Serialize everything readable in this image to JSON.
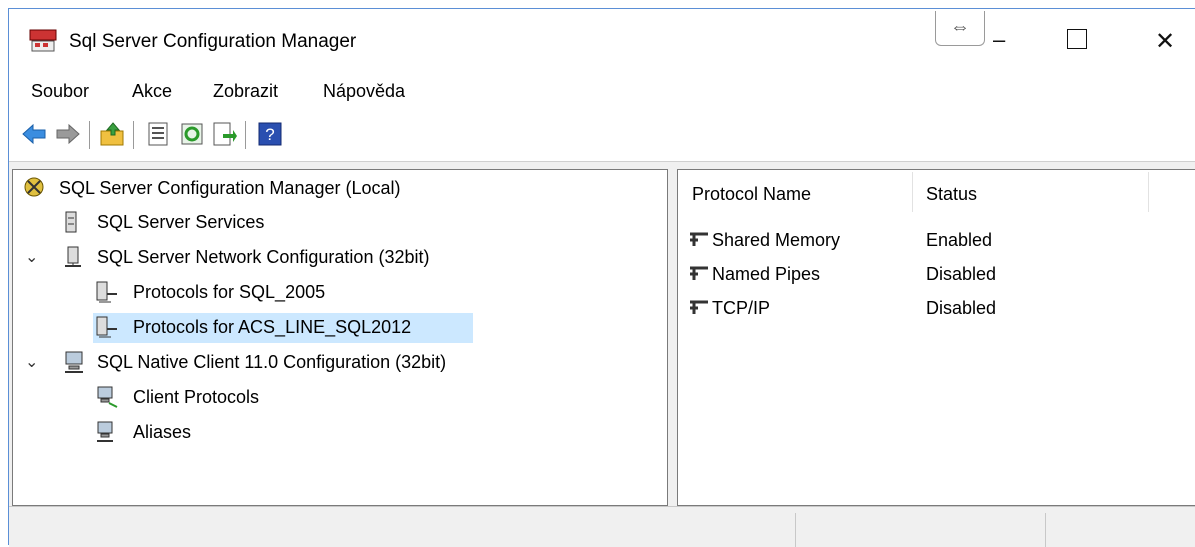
{
  "window": {
    "title": "Sql Server Configuration Manager",
    "controls": {
      "resize_hint": "⇔",
      "minimize": "–",
      "close": "✕"
    }
  },
  "menu": [
    "Soubor",
    "Akce",
    "Zobrazit",
    "Nápověda"
  ],
  "toolbar": {
    "icons": [
      "back-arrow-icon",
      "forward-arrow-icon",
      "up-folder-icon",
      "properties-icon",
      "refresh-icon",
      "export-list-icon",
      "help-icon"
    ]
  },
  "tree": {
    "root": "SQL Server Configuration Manager (Local)",
    "items": [
      {
        "label": "SQL Server Services",
        "level": 1
      },
      {
        "label": "SQL Server Network Configuration (32bit)",
        "level": 1,
        "expanded": true
      },
      {
        "label": "Protocols for SQL_2005",
        "level": 2
      },
      {
        "label": "Protocols for ACS_LINE_SQL2012",
        "level": 2,
        "selected": true
      },
      {
        "label": "SQL Native Client 11.0 Configuration (32bit)",
        "level": 1,
        "expanded": true
      },
      {
        "label": "Client Protocols",
        "level": 2
      },
      {
        "label": "Aliases",
        "level": 2
      }
    ]
  },
  "details": {
    "columns": [
      "Protocol Name",
      "Status"
    ],
    "rows": [
      {
        "name": "Shared Memory",
        "status": "Enabled"
      },
      {
        "name": "Named Pipes",
        "status": "Disabled"
      },
      {
        "name": "TCP/IP",
        "status": "Disabled"
      }
    ]
  },
  "colors": {
    "selection": "#cce8ff",
    "accent": "#5b8fd6"
  }
}
